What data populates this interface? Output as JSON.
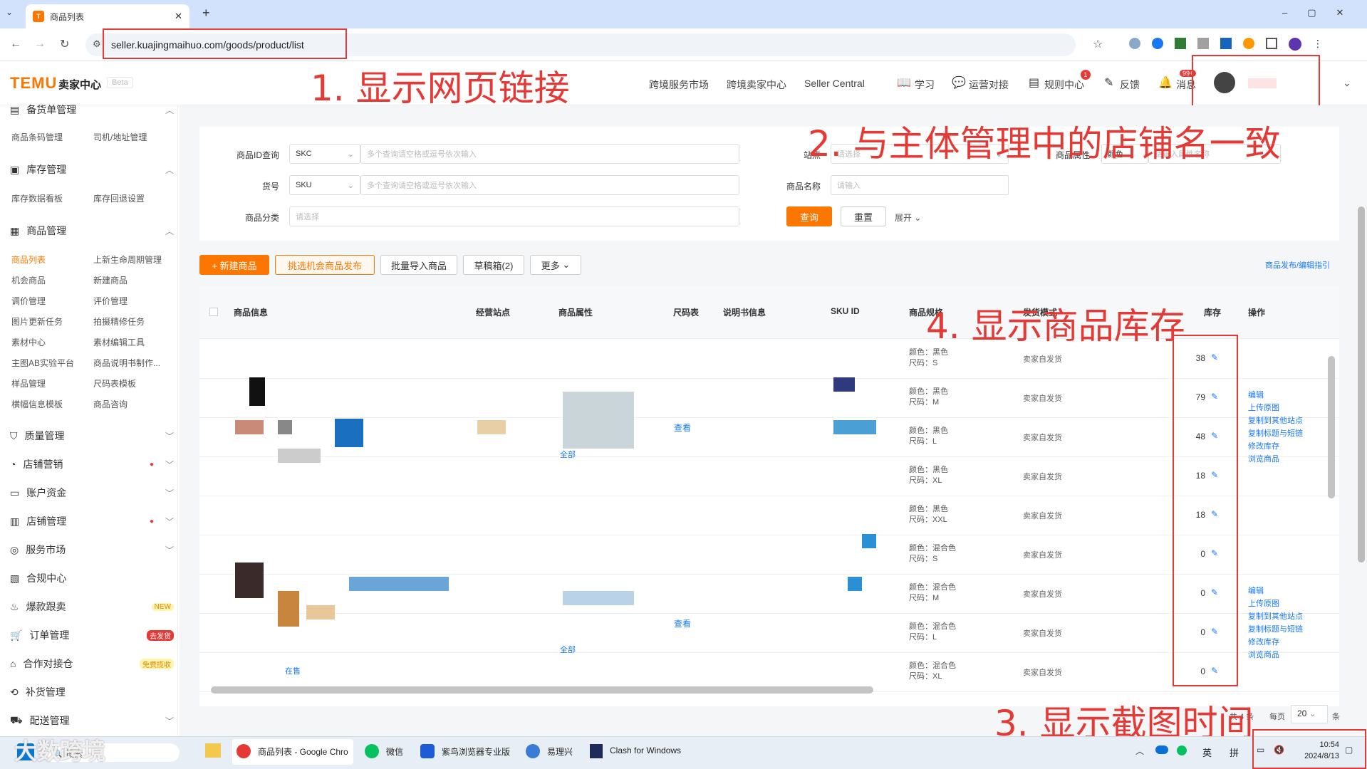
{
  "browser": {
    "tab_title": "商品列表",
    "url": "seller.kuajingmaihuo.com/goods/product/list"
  },
  "annotations": {
    "a1": "1. 显示网页链接",
    "a2": "2. 与主体管理中的店铺名一致",
    "a3": "3. 显示截图时间",
    "a4": "4. 显示商品库存"
  },
  "header": {
    "logo": "TEMU",
    "logo_sub": "卖家中心",
    "beta": "Beta",
    "nav": [
      "跨境服务市场",
      "跨境卖家中心",
      "Seller Central"
    ],
    "tools": [
      "学习",
      "运营对接",
      "规则中心",
      "反馈",
      "消息"
    ],
    "rule_badge": "1",
    "msg_badge": "99+"
  },
  "sidebar": {
    "top_partial": "备货单管理",
    "groups": [
      {
        "label": "库存管理",
        "items": [
          "库存数据看板",
          "库存回退设置"
        ]
      },
      {
        "label": "商品管理",
        "items": [
          "商品列表",
          "上新生命周期管理",
          "机会商品",
          "新建商品",
          "调价管理",
          "评价管理",
          "图片更新任务",
          "拍摄精修任务",
          "素材中心",
          "素材编辑工具",
          "主图AB实验平台",
          "商品说明书制作...",
          "样品管理",
          "尺码表模板",
          "横幅信息模板",
          "商品咨询"
        ]
      }
    ],
    "pre_items": [
      "商品条码管理",
      "司机/地址管理"
    ],
    "menus": [
      "质量管理",
      "店铺营销",
      "账户资金",
      "店铺管理",
      "服务市场",
      "合规中心",
      "爆款跟卖",
      "订单管理",
      "合作对接仓",
      "补货管理",
      "配送管理"
    ],
    "badge_new": "NEW",
    "badge_order": "去发货",
    "badge_coop": "免费揽收"
  },
  "filters": {
    "id_label": "商品ID查询",
    "id_type": "SKC",
    "id_placeholder": "多个查询请空格或逗号依次输入",
    "code_label": "货号",
    "code_type": "SKU",
    "code_placeholder": "多个查询请空格或逗号依次输入",
    "cat_label": "商品分类",
    "cat_placeholder": "请选择",
    "site_label": "站点",
    "site_placeholder": "请选择",
    "attr_label": "商品属性",
    "attr_type": "颜色",
    "attr_placeholder": "请输入属性名称",
    "name_label": "商品名称",
    "name_placeholder": "请输入",
    "query": "查询",
    "reset": "重置",
    "expand": "展开"
  },
  "toolbar": {
    "new_product": "+ 新建商品",
    "pick": "挑选机会商品发布",
    "batch": "批量导入商品",
    "drafts": "草稿箱(2)",
    "more": "更多",
    "guide": "商品发布/编辑指引"
  },
  "table": {
    "headers": [
      "商品信息",
      "经营站点",
      "商品属性",
      "尺码表",
      "说明书信息",
      "SKU ID",
      "商品规格",
      "发货模式",
      "库存",
      "操作"
    ],
    "view": "查看",
    "all": "全部",
    "status": "在售",
    "rows": [
      {
        "color": "颜色：黑色",
        "size": "尺码：S",
        "ship": "卖家自发货",
        "stock": "38"
      },
      {
        "color": "颜色：黑色",
        "size": "尺码：M",
        "ship": "卖家自发货",
        "stock": "79"
      },
      {
        "color": "颜色：黑色",
        "size": "尺码：L",
        "ship": "卖家自发货",
        "stock": "48"
      },
      {
        "color": "颜色：黑色",
        "size": "尺码：XL",
        "ship": "卖家自发货",
        "stock": "18"
      },
      {
        "color": "颜色：黑色",
        "size": "尺码：XXL",
        "ship": "卖家自发货",
        "stock": "18"
      },
      {
        "color": "颜色：混合色",
        "size": "尺码：S",
        "ship": "卖家自发货",
        "stock": "0"
      },
      {
        "color": "颜色：混合色",
        "size": "尺码：M",
        "ship": "卖家自发货",
        "stock": "0"
      },
      {
        "color": "颜色：混合色",
        "size": "尺码：L",
        "ship": "卖家自发货",
        "stock": "0"
      },
      {
        "color": "颜色：混合色",
        "size": "尺码：XL",
        "ship": "卖家自发货",
        "stock": "0"
      }
    ],
    "ops": [
      "编辑",
      "上传原图",
      "复制到其他站点",
      "复制标题与短链",
      "修改库存",
      "浏览商品"
    ]
  },
  "pagination": {
    "total": "共 4 条",
    "per_page": "每页",
    "size": "20",
    "unit": "条"
  },
  "taskbar": {
    "search": "搜索",
    "apps": [
      "商品列表 - Google Chro",
      "微信",
      "紫鸟浏览器专业版",
      "易理兴",
      "Clash for Windows"
    ],
    "ime1": "英",
    "ime2": "拼",
    "time": "10:54",
    "date": "2024/8/13",
    "watermark": "大数跨境"
  }
}
